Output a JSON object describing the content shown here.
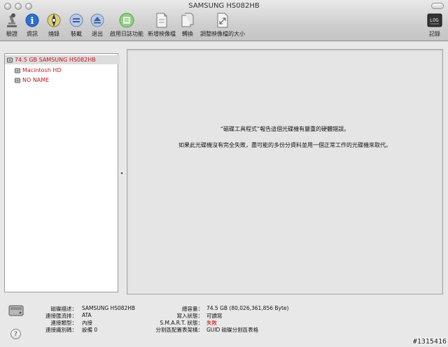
{
  "window": {
    "title": "SAMSUNG HS082HB"
  },
  "toolbar": {
    "items": [
      {
        "label": "驗證",
        "icon": "microscope-icon"
      },
      {
        "label": "資訊",
        "icon": "info-icon"
      },
      {
        "label": "燒錄",
        "icon": "burn-icon"
      },
      {
        "label": "裝載",
        "icon": "mount-icon"
      },
      {
        "label": "退出",
        "icon": "eject-icon"
      },
      {
        "label": "啟用日誌功能",
        "icon": "journal-icon"
      },
      {
        "label": "新增映像檔",
        "icon": "new-image-icon"
      },
      {
        "label": "轉換",
        "icon": "convert-icon"
      },
      {
        "label": "調整映像檔的大小",
        "icon": "resize-image-icon"
      }
    ],
    "log_label": "記錄"
  },
  "sidebar": {
    "items": [
      {
        "label": "74.5 GB SAMSUNG HS082HB",
        "level": 0,
        "selected": true
      },
      {
        "label": "Macintosh HD",
        "level": 1
      },
      {
        "label": "NO NAME",
        "level": 1
      }
    ]
  },
  "main": {
    "message_line1": "“磁碟工具程式”報告這個光碟機有嚴重的硬體錯誤。",
    "message_line2": "如果此光碟機沒有完全失敗，盡可能的多份分資料並用一個正常工作的光碟機來取代。"
  },
  "info": {
    "left": [
      {
        "key": "磁碟描述：",
        "value": "SAMSUNG HS082HB"
      },
      {
        "key": "連接匯流排：",
        "value": "ATA"
      },
      {
        "key": "連接類型：",
        "value": "內接"
      },
      {
        "key": "連接識別碼：",
        "value": "設備 0"
      }
    ],
    "right": [
      {
        "key": "總容量：",
        "value": "74.5 GB (80,026,361,856 Byte)"
      },
      {
        "key": "寫入狀態：",
        "value": "可讀寫"
      },
      {
        "key": "S.M.A.R.T. 狀態：",
        "value": "失敗"
      },
      {
        "key": "分割區配置表架構：",
        "value": "GUID 磁碟分割區表格"
      }
    ]
  },
  "help_label": "?",
  "watermark": "#1315416",
  "colors": {
    "error_red": "#d10a0a",
    "sidebar_text": "#c4161c"
  }
}
